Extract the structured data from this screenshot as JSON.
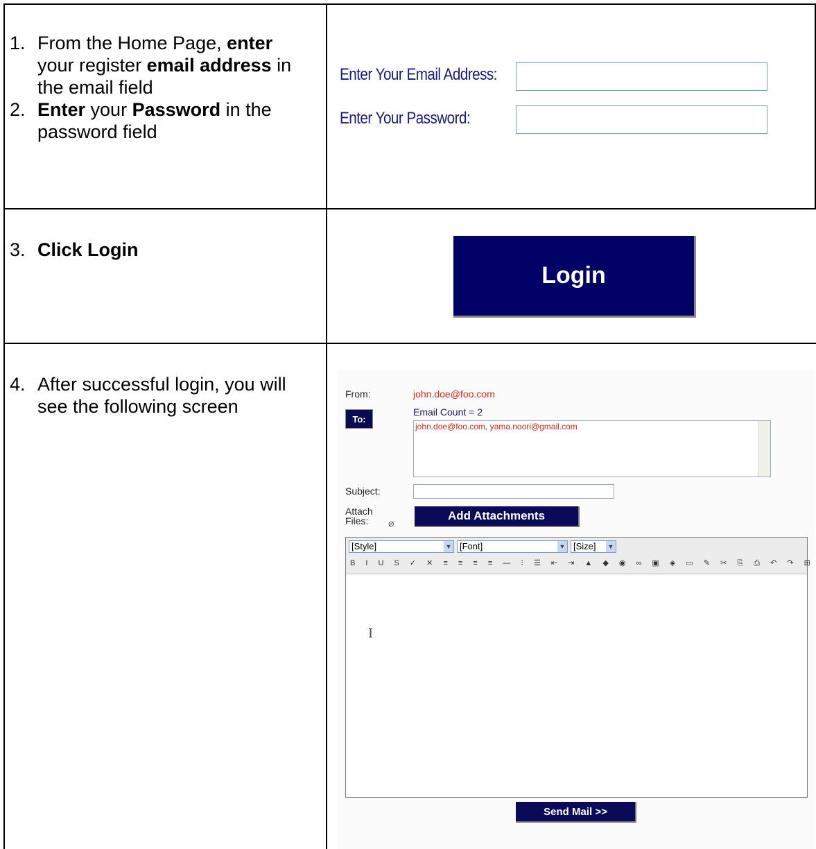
{
  "steps": [
    {
      "num": "1.",
      "parts": [
        "From the Home Page, ",
        "enter",
        " your register ",
        "email address",
        " in the email field"
      ]
    },
    {
      "num": "2.",
      "parts": [
        "Enter",
        " your ",
        "Password",
        " in the password field"
      ]
    },
    {
      "num": "3.",
      "parts": [
        "Click Login"
      ]
    },
    {
      "num": "4.",
      "parts": [
        "After successful login, you will see the following screen"
      ]
    }
  ],
  "login_form": {
    "email_label": "Enter Your Email Address:",
    "password_label": "Enter Your Password:",
    "login_button": "Login"
  },
  "composer": {
    "from_label": "From:",
    "from_value": "john.doe@foo.com",
    "to_button": "To:",
    "email_count": "Email Count = 2",
    "to_value": "john.doe@foo.com, yama.noori@gmail.com",
    "subject_label": "Subject:",
    "attach_label_1": "Attach",
    "attach_label_2": "Files:",
    "add_attachments_button": "Add Attachments",
    "style_select": "[Style]",
    "font_select": "[Font]",
    "size_select": "[Size]",
    "toolbar_glyphs": "B I U S ✓ ✕ ≡ ≡ ≡ ≡ — ⁝ ☰ ⇤ ⇥ ▲ ◆ ◉ ∞ ▣ ◈ ▭ ✎ ✂ ⎘ ⎙ ↶ ↷ ⊞",
    "send_button": "Send Mail >>"
  }
}
